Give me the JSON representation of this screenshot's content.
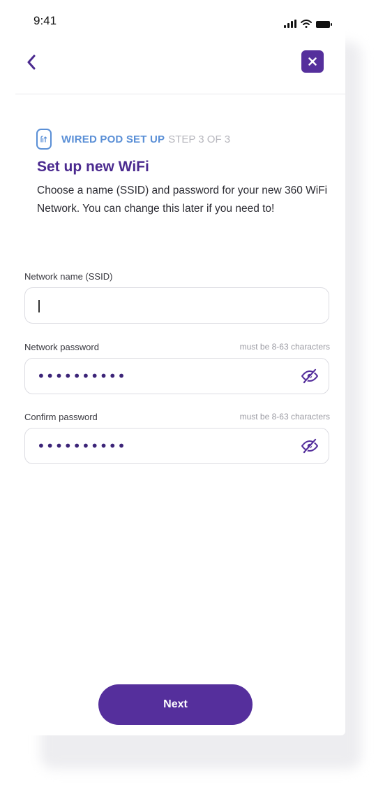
{
  "status_bar": {
    "time": "9:41",
    "icons": [
      "signal-icon",
      "wifi-icon",
      "battery-icon"
    ]
  },
  "nav": {
    "back_icon": "chevron-left-icon",
    "close_icon": "close-icon"
  },
  "step": {
    "icon": "wired-pod-icon",
    "title": "WIRED POD SET UP",
    "count": "STEP 3 OF 3"
  },
  "page": {
    "title": "Set up new WiFi",
    "description": "Choose a name (SSID) and password for your new 360 WiFi Network. You can change this later if you need to!"
  },
  "form": {
    "ssid": {
      "label": "Network name (SSID)",
      "value": ""
    },
    "password": {
      "label": "Network password",
      "hint": "must be 8-63 characters",
      "masked_value": "••••••••••",
      "toggle_icon": "eye-slash-icon"
    },
    "confirm": {
      "label": "Confirm password",
      "hint": "must be 8-63 characters",
      "masked_value": "••••••••••",
      "toggle_icon": "eye-slash-icon"
    }
  },
  "actions": {
    "next_label": "Next"
  },
  "colors": {
    "primary": "#552f9c",
    "title": "#4b2a8f",
    "accent_blue": "#5a8fd6",
    "muted": "#b6b6bd"
  }
}
